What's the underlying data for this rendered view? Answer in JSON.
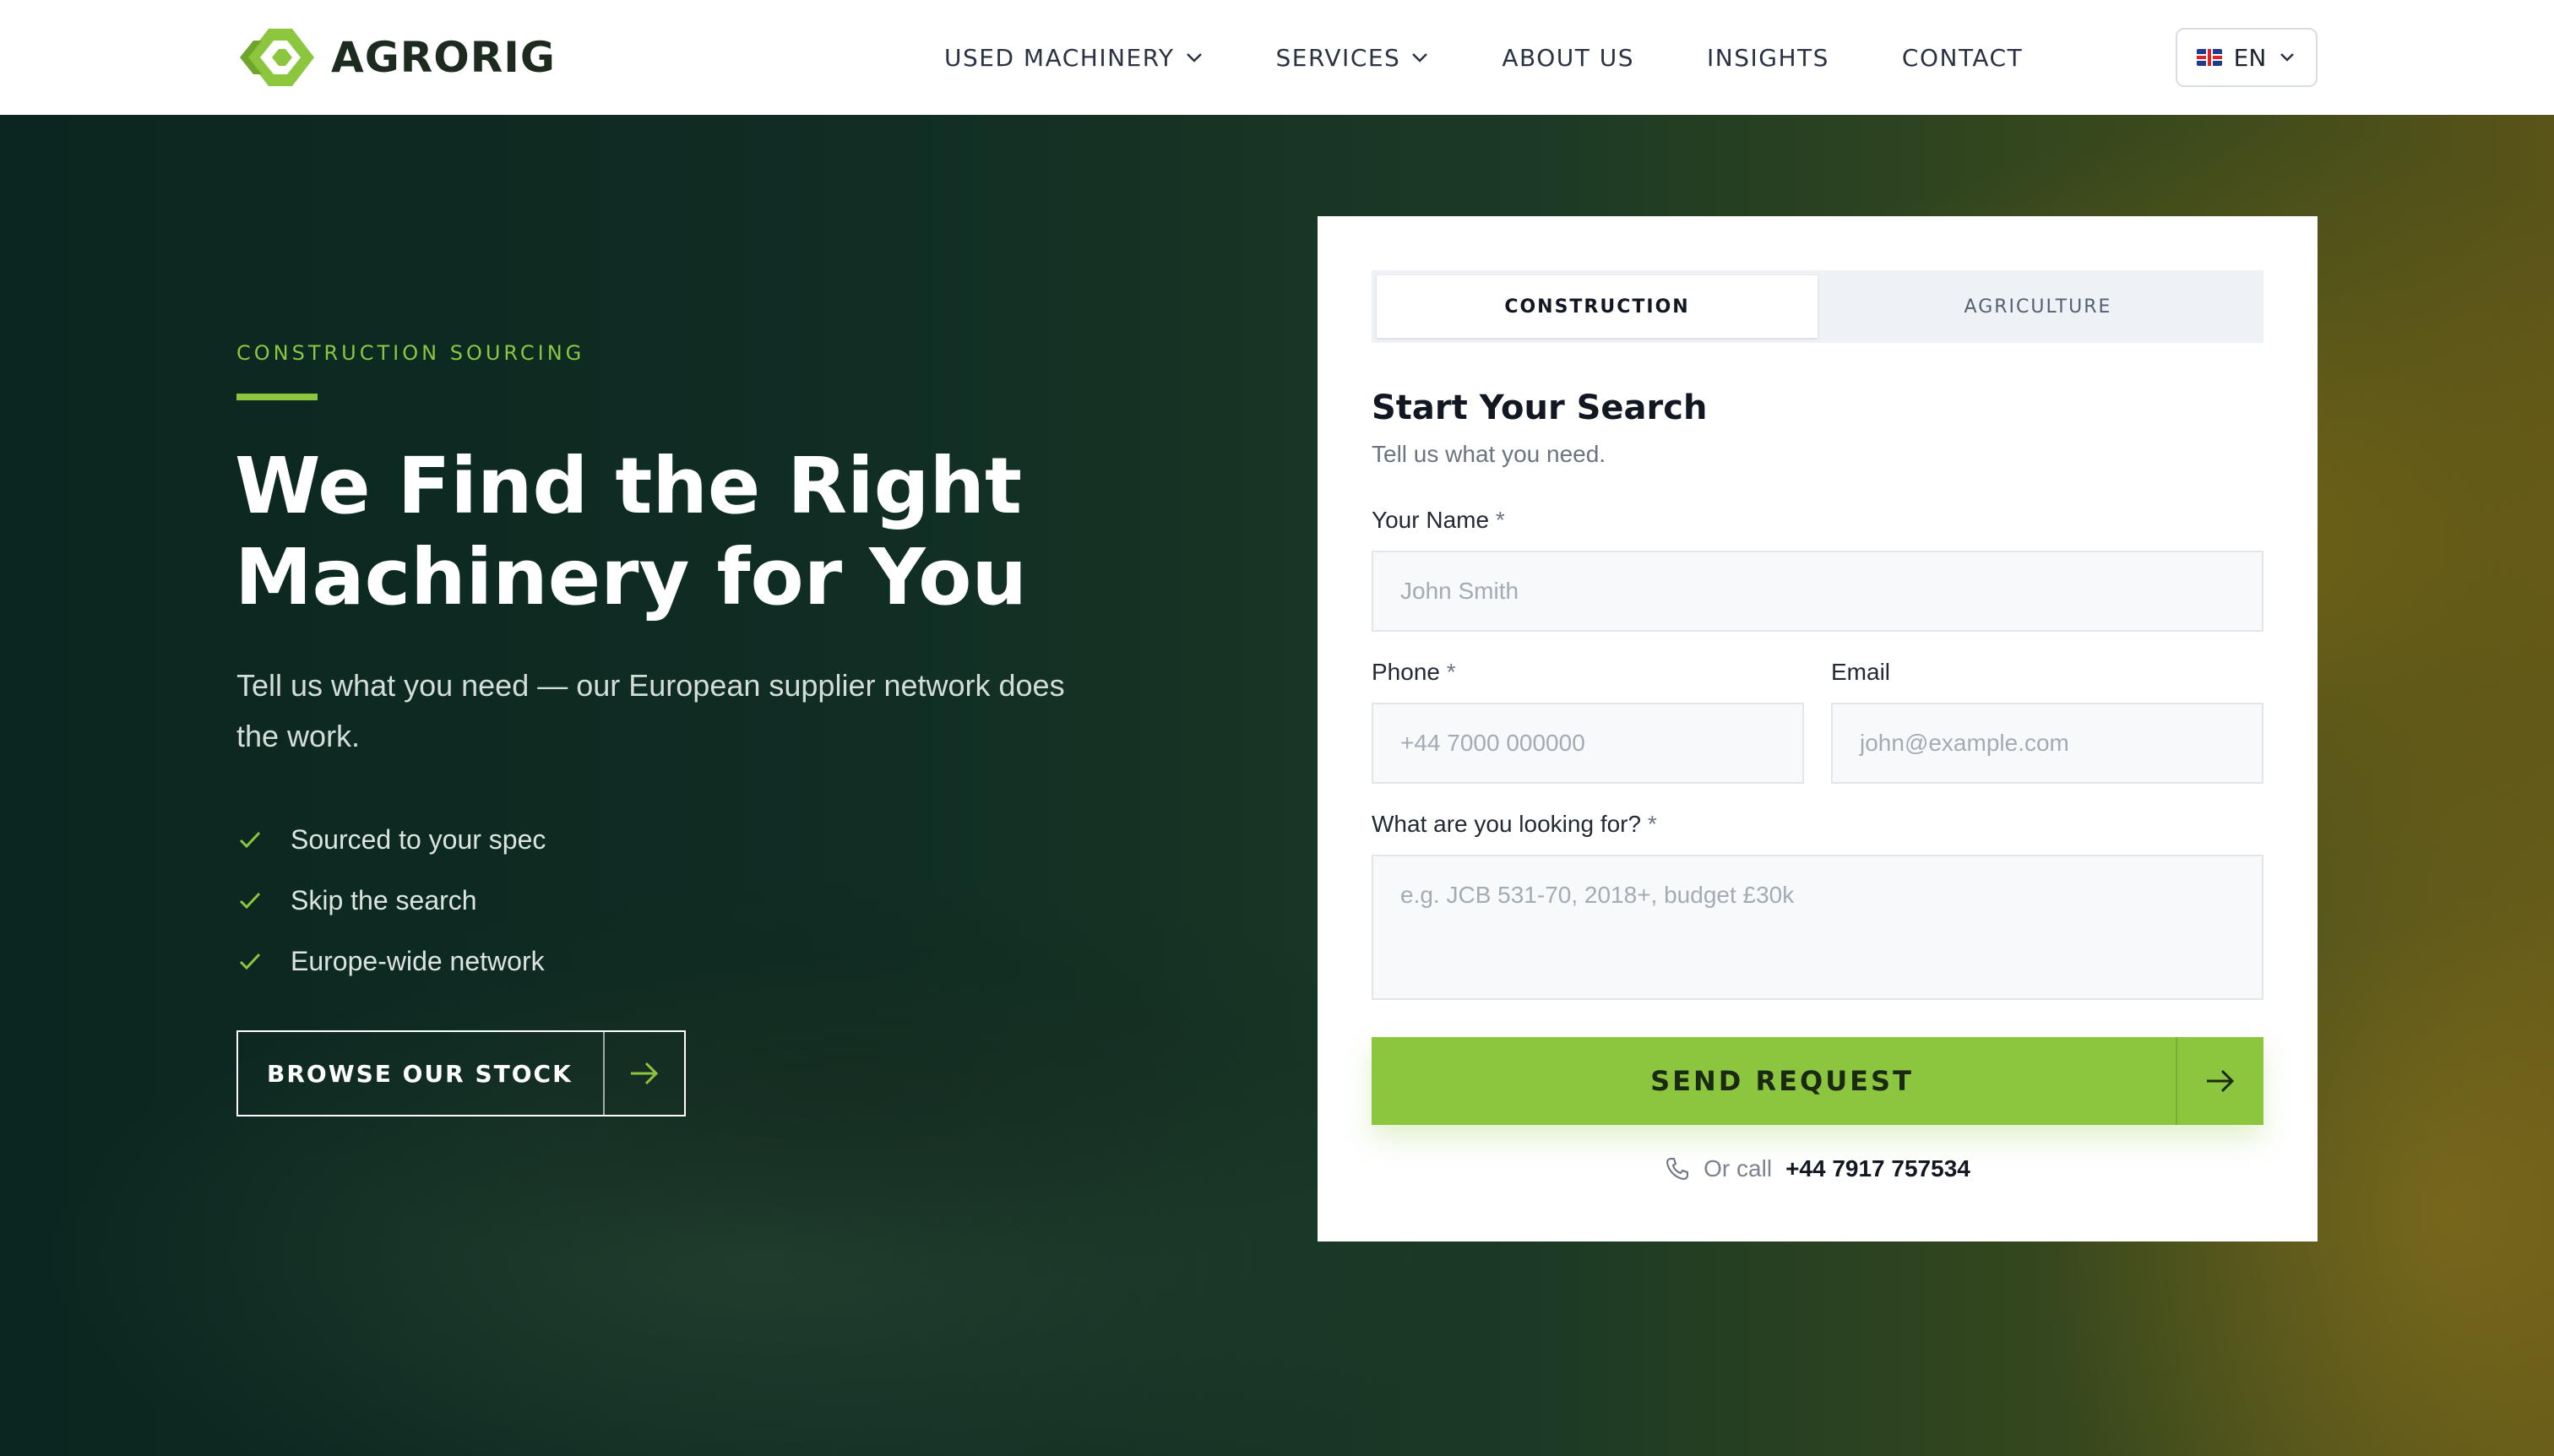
{
  "brand": {
    "name": "AGRORIG",
    "accent": "#8cc63f"
  },
  "nav": {
    "items": [
      {
        "label": "USED MACHINERY",
        "dropdown": true
      },
      {
        "label": "SERVICES",
        "dropdown": true
      },
      {
        "label": "ABOUT US",
        "dropdown": false
      },
      {
        "label": "INSIGHTS",
        "dropdown": false
      },
      {
        "label": "CONTACT",
        "dropdown": false
      }
    ],
    "language": "EN"
  },
  "hero": {
    "eyebrow": "CONSTRUCTION SOURCING",
    "title": "We Find the Right Machinery for You",
    "subtitle": "Tell us what you need — our European supplier network does the work.",
    "checklist": [
      "Sourced to your spec",
      "Skip the search",
      "Europe-wide network"
    ],
    "cta_label": "BROWSE OUR STOCK"
  },
  "form": {
    "tabs": [
      {
        "label": "CONSTRUCTION",
        "active": true
      },
      {
        "label": "AGRICULTURE",
        "active": false
      }
    ],
    "title": "Start Your Search",
    "subtitle": "Tell us what you need.",
    "name_label": "Your Name",
    "name_placeholder": "John Smith",
    "phone_label": "Phone",
    "phone_placeholder": "+44 7000 000000",
    "email_label": "Email",
    "email_placeholder": "john@example.com",
    "need_label": "What are you looking for?",
    "need_placeholder": "e.g. JCB 531-70, 2018+, budget £30k",
    "required_mark": "*",
    "submit_label": "SEND REQUEST",
    "call_prefix": "Or call",
    "call_phone": "+44 7917 757534"
  }
}
